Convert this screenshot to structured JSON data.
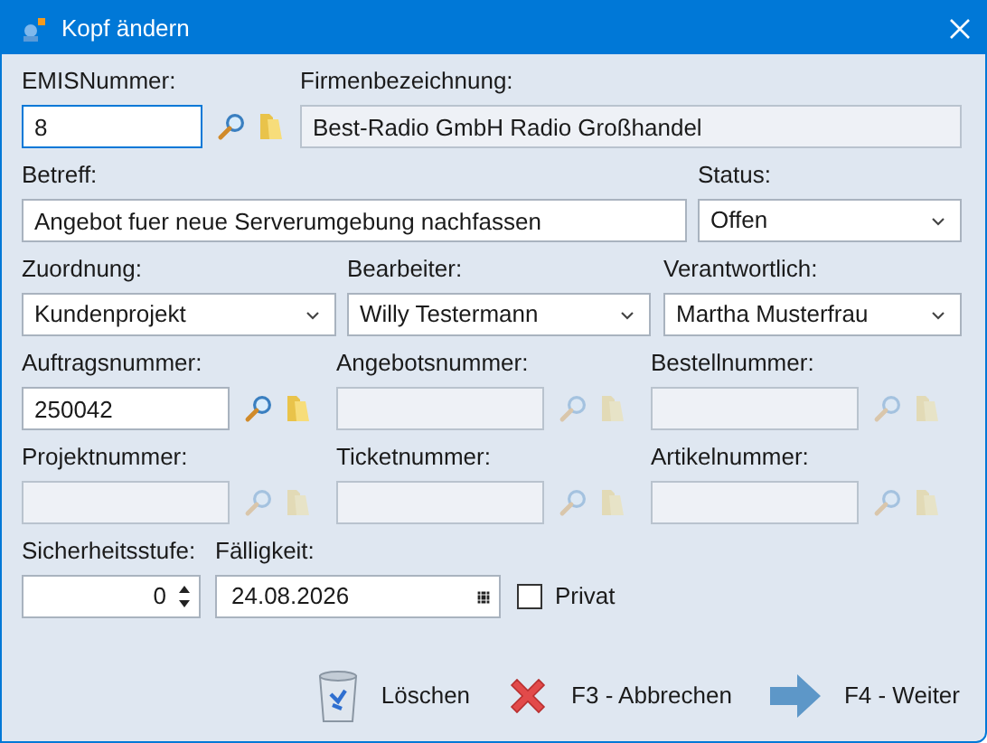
{
  "window": {
    "title": "Kopf ändern"
  },
  "rows": [
    [
      {
        "kind": "lookup",
        "label": "EMISNummer:",
        "value": "8",
        "disabled": false,
        "focused": true
      },
      {
        "kind": "text",
        "label": "Firmenbezeichnung:",
        "value": "Best-Radio GmbH Radio Großhandel",
        "disabled": true,
        "focused": false
      }
    ],
    [
      {
        "kind": "text",
        "label": "Betreff:",
        "value": "Angebot fuer neue Serverumgebung nachfassen",
        "disabled": false,
        "focused": false
      },
      {
        "kind": "combo",
        "label": "Status:",
        "value": "Offen",
        "disabled": false,
        "focused": false
      }
    ],
    [
      {
        "kind": "combo",
        "label": "Zuordnung:",
        "value": "Kundenprojekt",
        "disabled": false,
        "focused": false
      },
      {
        "kind": "combo",
        "label": "Bearbeiter:",
        "value": "Willy Testermann",
        "disabled": false,
        "focused": false
      },
      {
        "kind": "combo",
        "label": "Verantwortlich:",
        "value": "Martha Musterfrau",
        "disabled": false,
        "focused": false
      }
    ],
    [
      {
        "kind": "lookup",
        "label": "Auftragsnummer:",
        "value": "250042",
        "disabled": false,
        "focused": false
      },
      {
        "kind": "lookup",
        "label": "Angebotsnummer:",
        "disabled": true,
        "focused": false
      },
      {
        "kind": "lookup",
        "label": "Bestellnummer:",
        "disabled": true,
        "focused": false
      }
    ],
    [
      {
        "kind": "lookup",
        "label": "Projektnummer:",
        "disabled": true,
        "focused": false
      },
      {
        "kind": "lookup",
        "label": "Ticketnummer:",
        "disabled": true,
        "focused": false
      },
      {
        "kind": "lookup",
        "label": "Artikelnummer:",
        "disabled": true,
        "focused": false
      }
    ],
    [
      {
        "kind": "spinner",
        "label": "Sicherheitsstufe:",
        "value": "0",
        "disabled": false,
        "focused": false
      },
      {
        "kind": "date",
        "label": "Fälligkeit:",
        "value": "24.08.2026",
        "disabled": false,
        "focused": false
      },
      {
        "kind": "checkbox",
        "label": "Privat",
        "checked": false
      }
    ]
  ],
  "buttons": [
    {
      "kind": "delete",
      "label": "Löschen"
    },
    {
      "kind": "cancel",
      "label": "F3 - Abbrechen"
    },
    {
      "kind": "next",
      "label": "F4 - Weiter"
    }
  ]
}
